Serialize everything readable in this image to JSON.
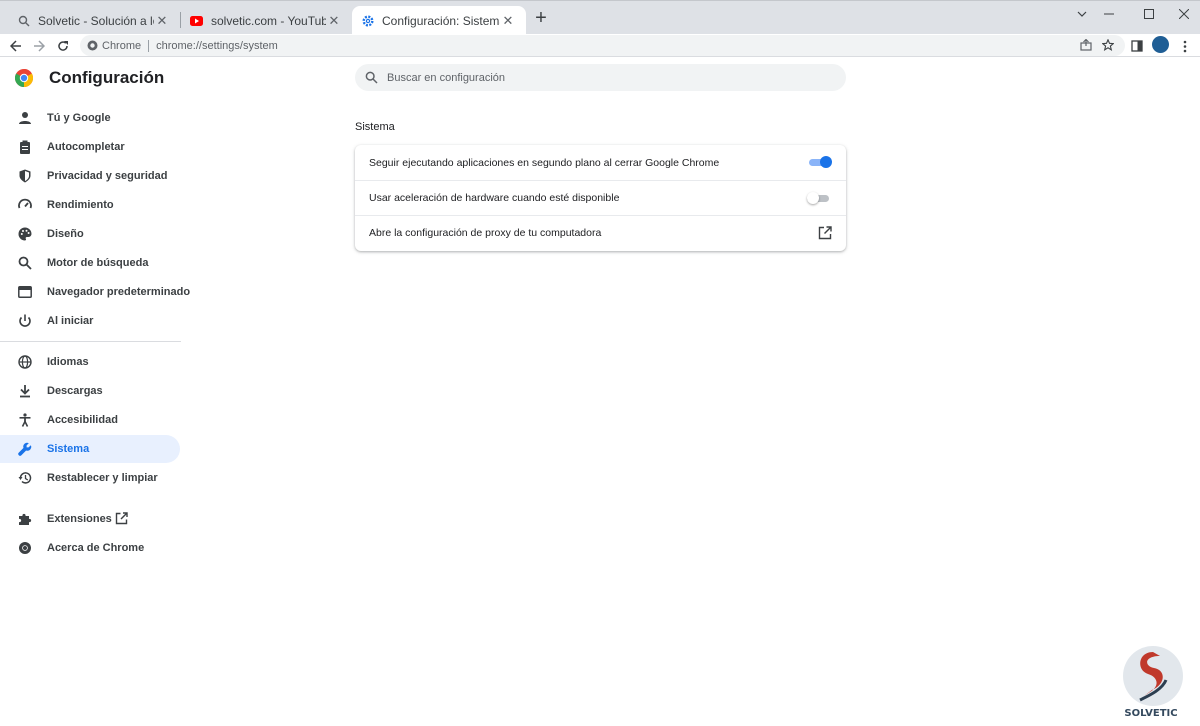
{
  "tabs": [
    {
      "title": "Solvetic - Solución a los problem",
      "icon": "search-favicon-icon"
    },
    {
      "title": "solvetic.com - YouTube",
      "icon": "youtube-icon"
    },
    {
      "title": "Configuración: Sistema",
      "icon": "gear-icon",
      "active": true
    }
  ],
  "toolbar": {
    "omnibox_chrome": "Chrome",
    "omnibox_url": "chrome://settings/system"
  },
  "header": {
    "title": "Configuración"
  },
  "sidebar": {
    "items": [
      {
        "label": "Tú y Google",
        "icon": "person-icon"
      },
      {
        "label": "Autocompletar",
        "icon": "clipboard-icon"
      },
      {
        "label": "Privacidad y seguridad",
        "icon": "shield-icon"
      },
      {
        "label": "Rendimiento",
        "icon": "speedometer-icon"
      },
      {
        "label": "Diseño",
        "icon": "palette-icon"
      },
      {
        "label": "Motor de búsqueda",
        "icon": "search-icon"
      },
      {
        "label": "Navegador predeterminado",
        "icon": "browser-window-icon"
      },
      {
        "label": "Al iniciar",
        "icon": "power-icon"
      },
      {
        "label": "Idiomas",
        "icon": "globe-icon"
      },
      {
        "label": "Descargas",
        "icon": "download-icon"
      },
      {
        "label": "Accesibilidad",
        "icon": "accessibility-icon"
      },
      {
        "label": "Sistema",
        "icon": "wrench-icon",
        "selected": true
      },
      {
        "label": "Restablecer y limpiar",
        "icon": "restore-icon"
      },
      {
        "label": "Extensiones",
        "icon": "puzzle-icon"
      },
      {
        "label": "Acerca de Chrome",
        "icon": "chrome-logo-icon"
      }
    ]
  },
  "search": {
    "placeholder": "Buscar en configuración"
  },
  "main": {
    "section_title": "Sistema",
    "rows": [
      {
        "label": "Seguir ejecutando aplicaciones en segundo plano al cerrar Google Chrome",
        "control": "toggle",
        "checked": true
      },
      {
        "label": "Usar aceleración de hardware cuando esté disponible",
        "control": "toggle",
        "checked": false
      },
      {
        "label": "Abre la configuración de proxy de tu computadora",
        "control": "external-link"
      }
    ]
  },
  "watermark": {
    "text": "SOLVETIC"
  },
  "colors": {
    "accent": "#1a73e8",
    "selected_bg": "#e8f0fe",
    "tabstrip": "#dee1e6"
  }
}
